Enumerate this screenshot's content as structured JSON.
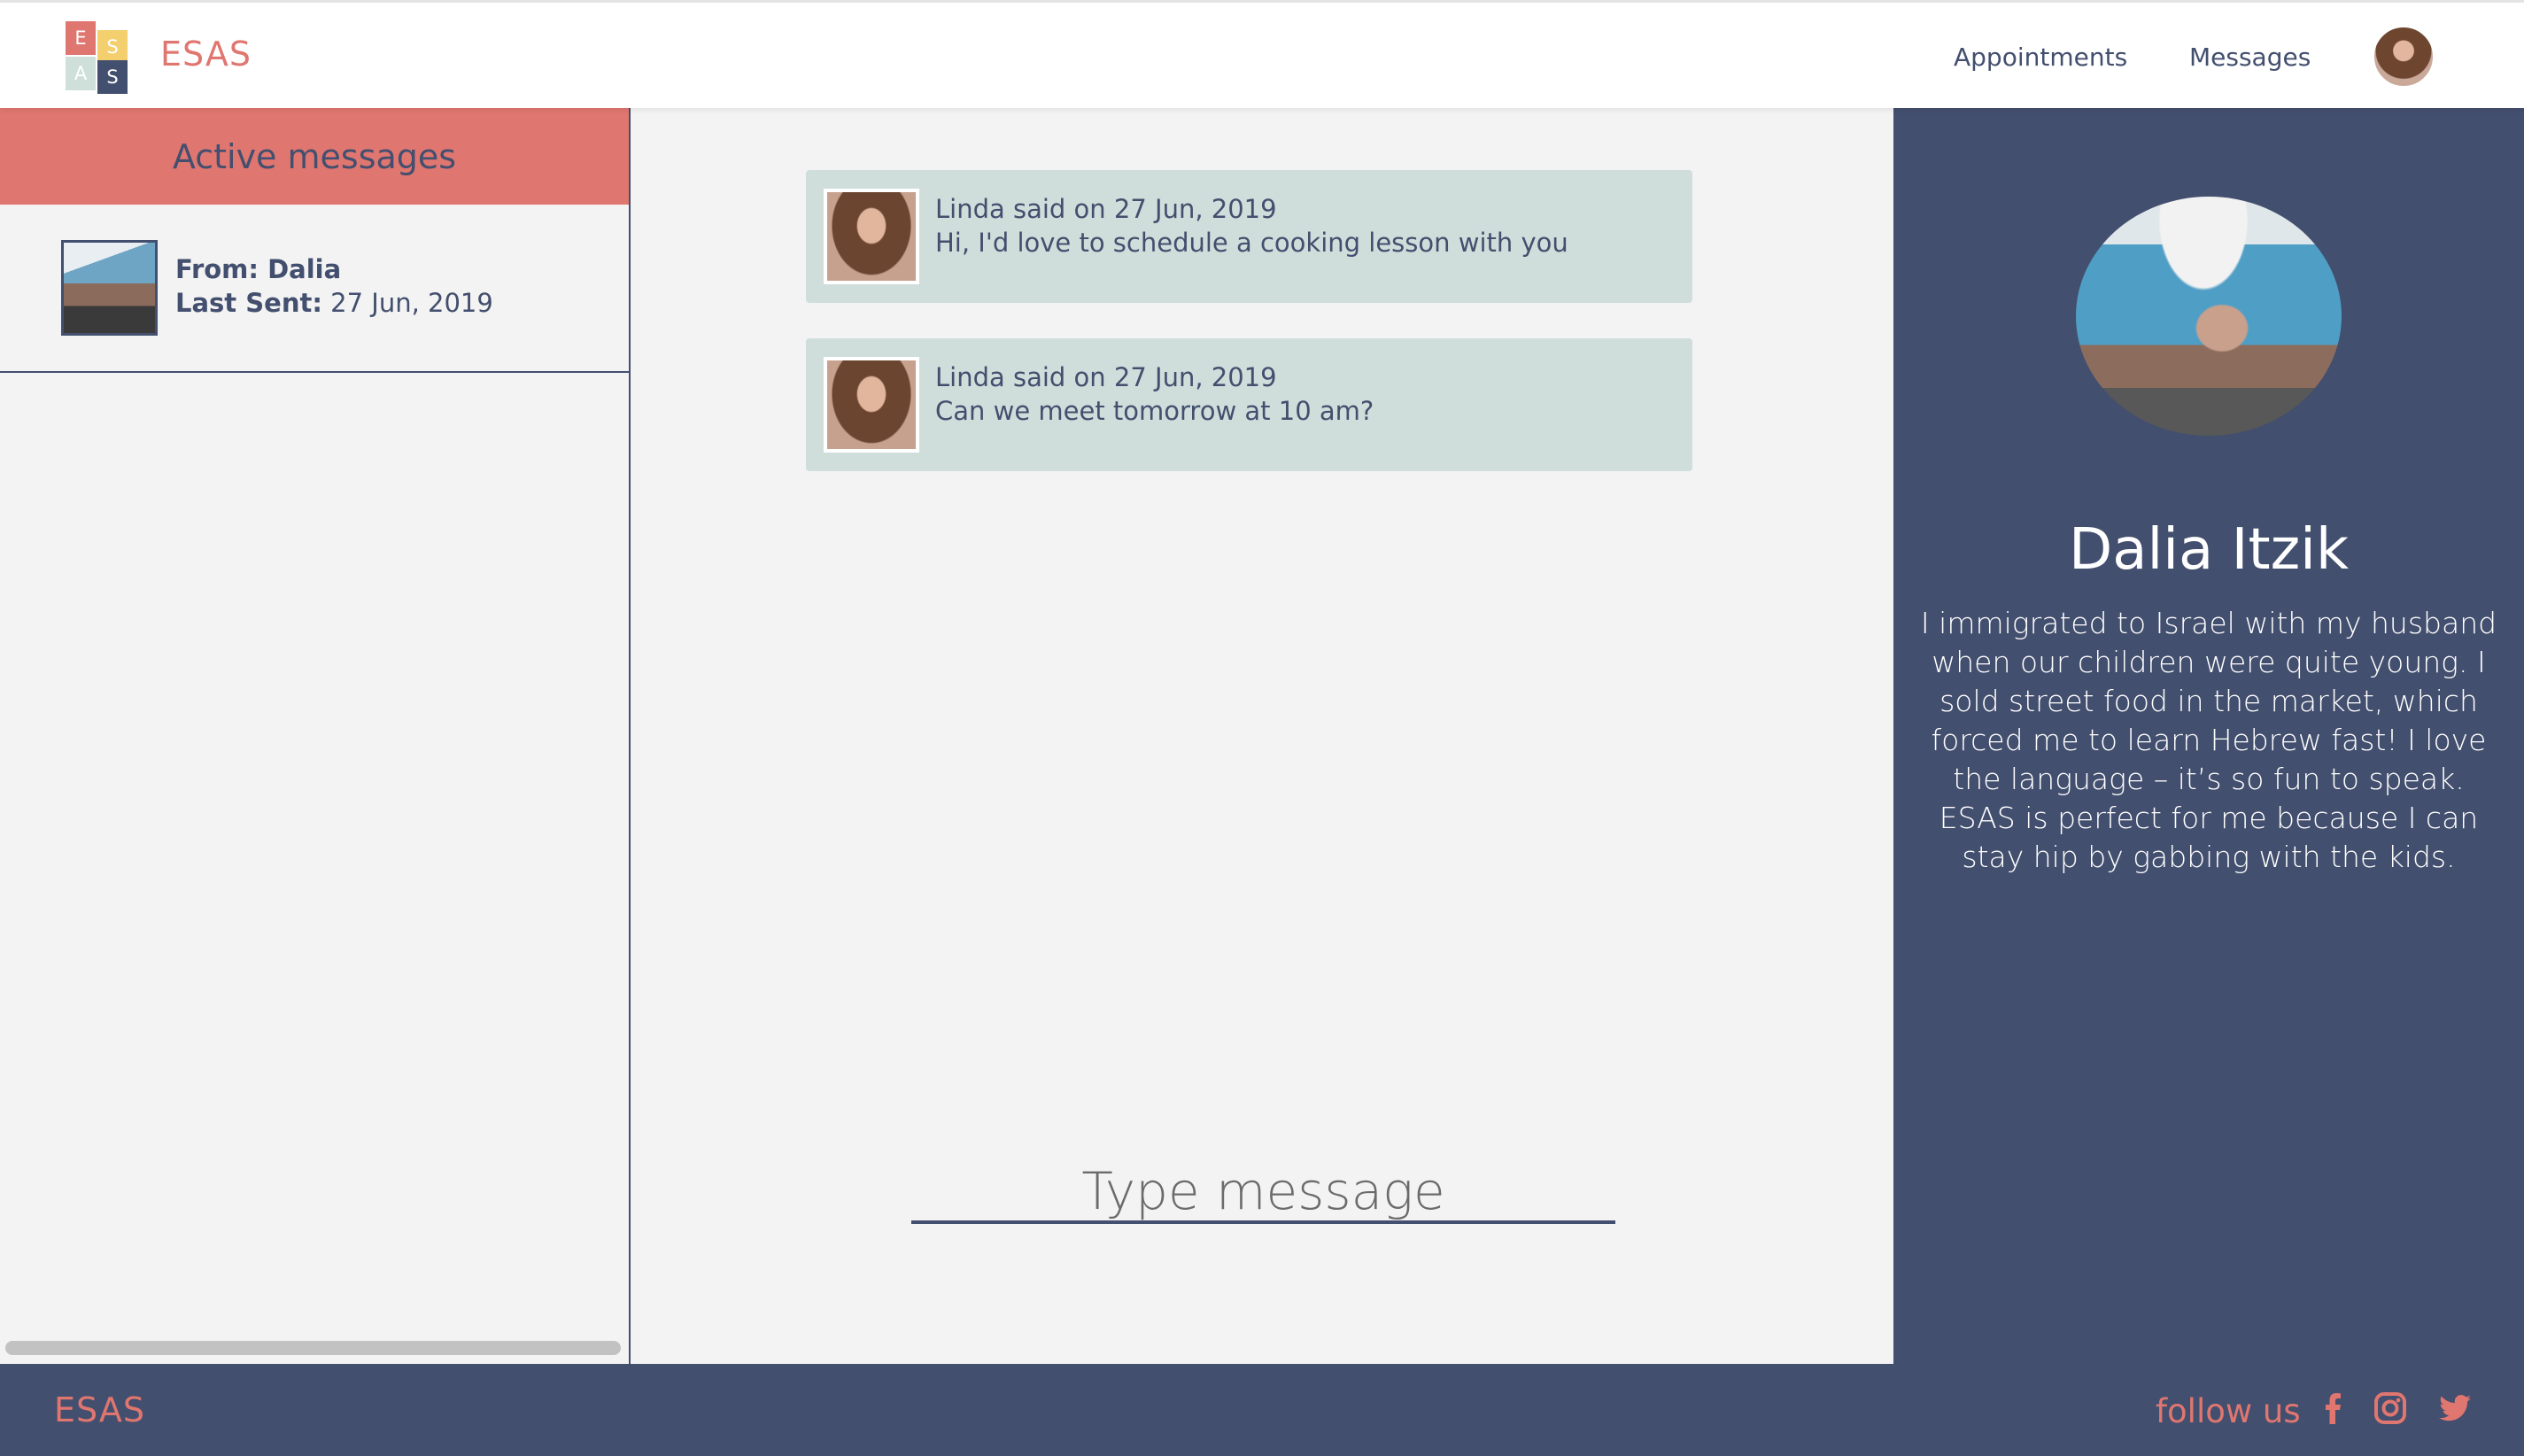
{
  "header": {
    "logo_letters": [
      "E",
      "S",
      "A",
      "S"
    ],
    "brand": "ESAS",
    "nav": {
      "appointments": "Appointments",
      "messages": "Messages"
    }
  },
  "sidebar": {
    "title": "Active messages",
    "threads": [
      {
        "from_label": "From: Dalia",
        "last_sent_label": "Last Sent:",
        "last_sent_value": "27 Jun, 2019"
      }
    ]
  },
  "chat": {
    "messages": [
      {
        "meta": "Linda said on 27 Jun, 2019",
        "text": "Hi, I'd love to schedule a cooking lesson with you"
      },
      {
        "meta": "Linda said on 27 Jun, 2019",
        "text": "Can we meet tomorrow at 10 am?"
      }
    ],
    "input_placeholder": "Type message"
  },
  "profile": {
    "name": "Dalia Itzik",
    "bio": "I immigrated to Israel with my husband when our children were quite young. I sold street food in the market, which forced me to learn Hebrew fast! I love the language – it’s so fun to speak. ESAS is perfect for me because I can stay hip by gabbing with the kids."
  },
  "footer": {
    "brand": "ESAS",
    "follow": "follow us",
    "social_icons": [
      "facebook-icon",
      "instagram-icon",
      "twitter-icon"
    ]
  },
  "colors": {
    "accent": "#e07670",
    "navy": "#434f6e",
    "message_bg": "#cfdedb",
    "panel_bg": "#f3f3f3",
    "logo_yellow": "#f4cf6e",
    "logo_mint": "#cfe0da"
  }
}
